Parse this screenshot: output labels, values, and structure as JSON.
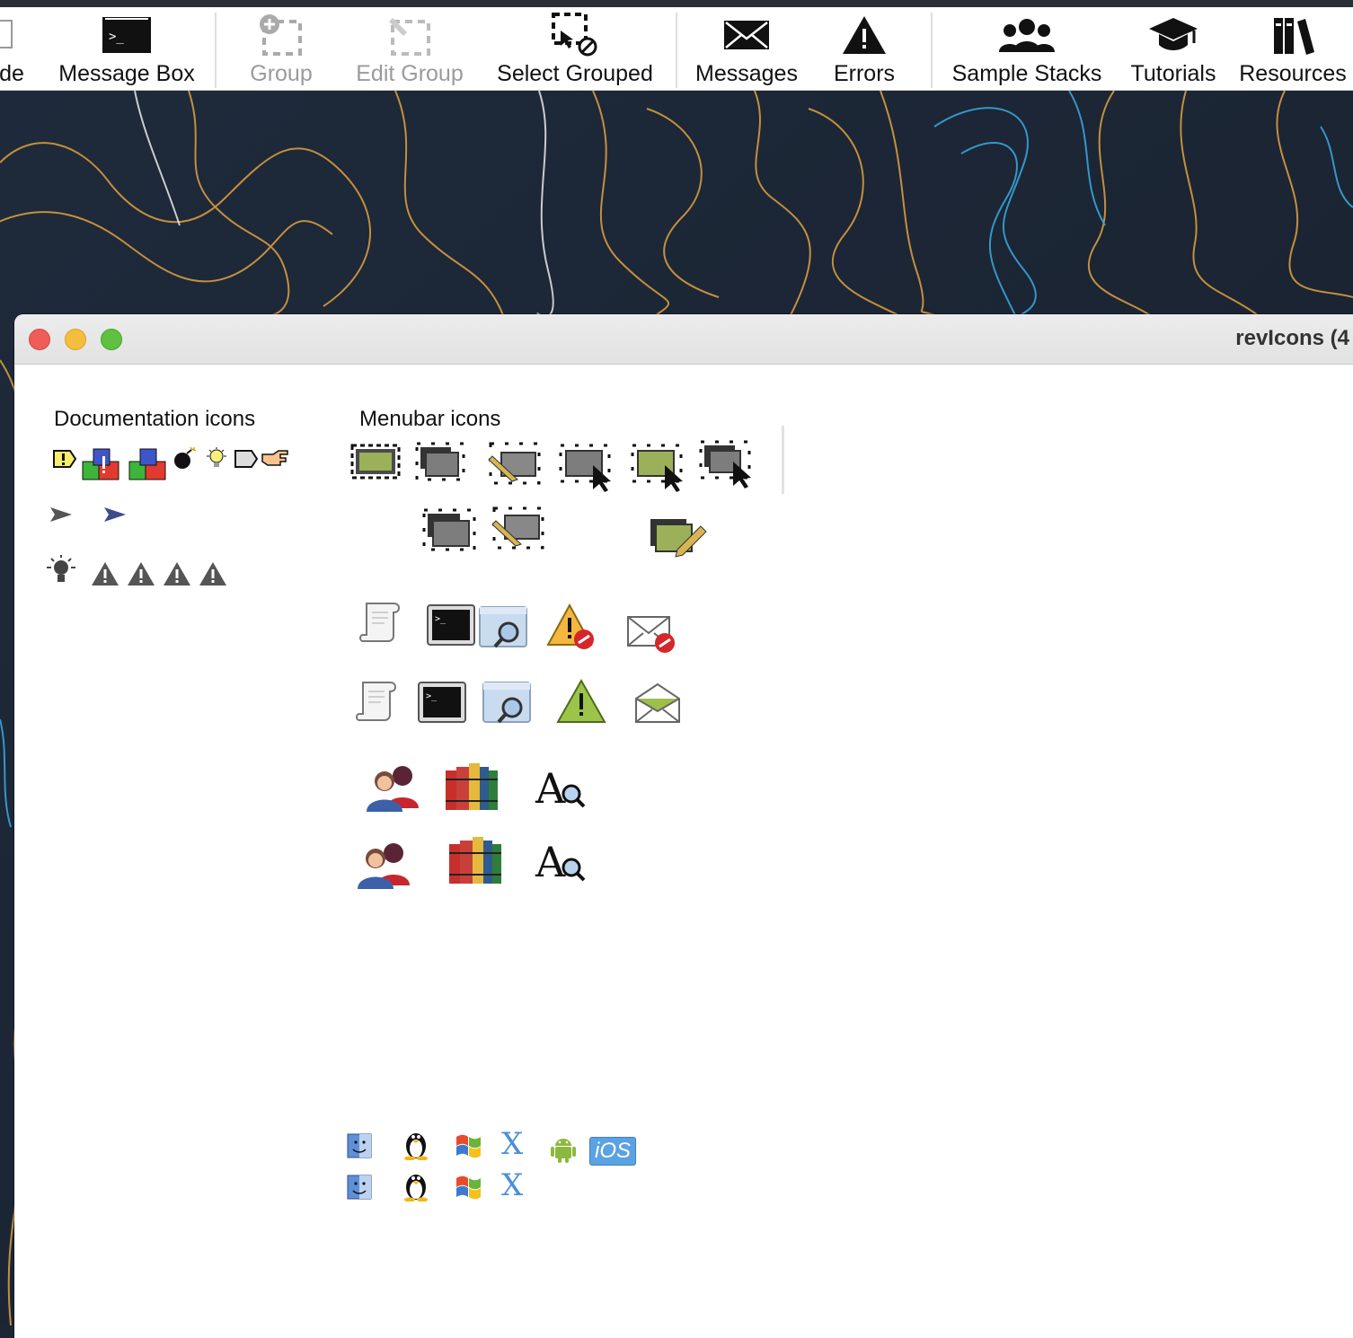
{
  "toolbar": {
    "items": [
      {
        "label": "de"
      },
      {
        "label": "Message Box"
      },
      {
        "label": "Group"
      },
      {
        "label": "Edit Group"
      },
      {
        "label": "Select Grouped"
      },
      {
        "label": "Messages"
      },
      {
        "label": "Errors"
      },
      {
        "label": "Sample Stacks"
      },
      {
        "label": "Tutorials"
      },
      {
        "label": "Resources"
      }
    ]
  },
  "window": {
    "title": "revIcons (4",
    "sections": {
      "documentation": "Documentation icons",
      "menubar": "Menubar icons"
    }
  },
  "platform_icons": {
    "ios_label": "iOS",
    "x_label": "X"
  },
  "colors": {
    "close": "#ee5e56",
    "minimize": "#f5bd3c",
    "zoom": "#5fc13f",
    "desktop": "#1c2636"
  }
}
